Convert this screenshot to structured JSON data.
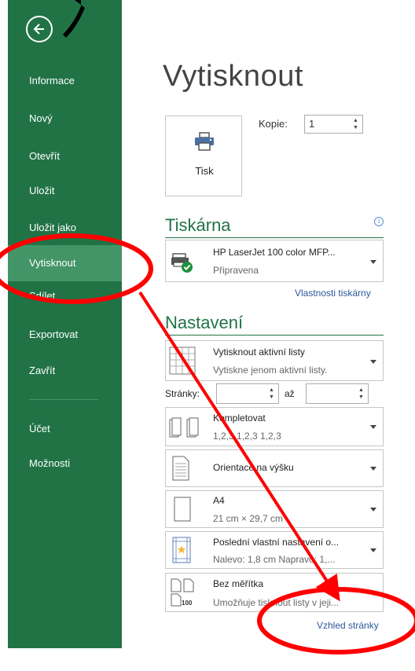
{
  "sidebar": {
    "items": [
      {
        "label": "Informace"
      },
      {
        "label": "Nový"
      },
      {
        "label": "Otevřít"
      },
      {
        "label": "Uložit"
      },
      {
        "label": "Uložit jako"
      },
      {
        "label": "Vytisknout",
        "active": true
      },
      {
        "label": "Sdílet"
      },
      {
        "label": "Exportovat"
      },
      {
        "label": "Zavřít"
      },
      {
        "label": "Účet"
      },
      {
        "label": "Možnosti"
      }
    ]
  },
  "main": {
    "title": "Vytisknout",
    "print_button_label": "Tisk",
    "copies_label": "Kopie:",
    "copies_value": "1",
    "printer_section_title": "Tiskárna",
    "printer": {
      "name": "HP LaserJet 100 color MFP...",
      "status": "Připravena"
    },
    "printer_properties_link": "Vlastnosti tiskárny",
    "settings_section_title": "Nastavení",
    "settings": [
      {
        "l1": "Vytisknout aktivní listy",
        "l2": "Vytiskne jenom aktivní listy."
      },
      {
        "l1": "Kompletovat",
        "l2": "1,2,3   1,2,3   1,2,3"
      },
      {
        "l1": "Orientace na výšku",
        "l2": ""
      },
      {
        "l1": "A4",
        "l2": "21 cm × 29,7 cm"
      },
      {
        "l1": "Poslední vlastní nastavení o...",
        "l2": "Nalevo: 1,8 cm   Napravo: 1,..."
      },
      {
        "l1": "Bez měřítka",
        "l2": "Umožňuje tisknout listy v jeji..."
      }
    ],
    "pages_label": "Stránky:",
    "pages_to_label": "až",
    "page_setup_link": "Vzhled stránky"
  },
  "colors": {
    "accent": "#217346",
    "active": "#439467",
    "annotation": "#ff0000",
    "link": "#2b579a"
  }
}
